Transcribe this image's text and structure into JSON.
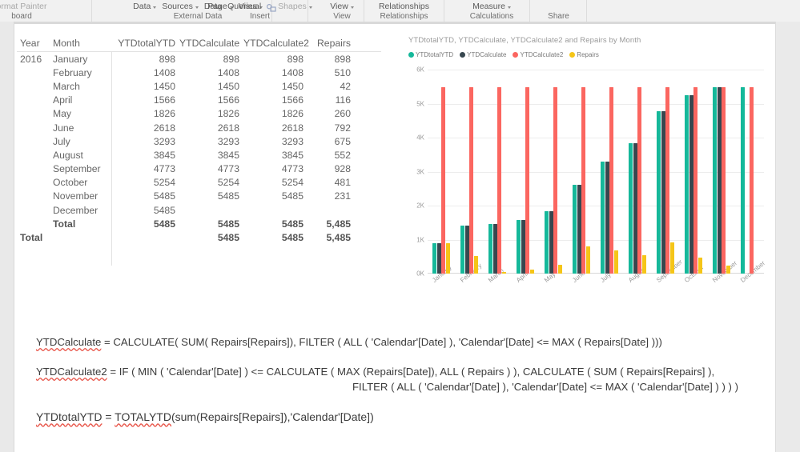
{
  "ribbon": {
    "groups": [
      {
        "name": "clipboard",
        "label": "board",
        "items": [
          {
            "text": "ormat Painter",
            "caret": false,
            "faded": true
          }
        ]
      },
      {
        "name": "external-data",
        "label": "External Data",
        "items": [
          {
            "text": "Data",
            "caret": true,
            "faded": false
          },
          {
            "text": "Sources",
            "caret": true,
            "faded": false
          },
          {
            "text": "Data",
            "caret": false,
            "faded": false
          },
          {
            "text": "Queries",
            "caret": true,
            "faded": false
          }
        ]
      },
      {
        "name": "insert",
        "label": "Insert",
        "items": [
          {
            "text": "Page",
            "caret": true,
            "faded": false
          },
          {
            "text": "Visual",
            "caret": false,
            "faded": false
          },
          {
            "text": "Shapes",
            "caret": true,
            "faded": true,
            "icon": "shapes-icon"
          }
        ]
      },
      {
        "name": "view",
        "label": "View",
        "items": [
          {
            "text": "View",
            "caret": true,
            "faded": false
          }
        ]
      },
      {
        "name": "relationships",
        "label": "Relationships",
        "items": [
          {
            "text": "Relationships",
            "caret": false,
            "faded": false
          }
        ]
      },
      {
        "name": "calculations",
        "label": "Calculations",
        "items": [
          {
            "text": "Measure",
            "caret": true,
            "faded": false
          }
        ]
      },
      {
        "name": "share",
        "label": "Share",
        "items": []
      }
    ]
  },
  "matrix": {
    "columns": [
      "Year",
      "Month",
      "YTDtotalYTD",
      "YTDCalculate",
      "YTDCalculate2",
      "Repairs"
    ],
    "year": "2016",
    "rows": [
      {
        "month": "January",
        "ytdtotalytd": "898",
        "ytdcalculate": "898",
        "ytdcalculate2": "898",
        "repairs": "898"
      },
      {
        "month": "February",
        "ytdtotalytd": "1408",
        "ytdcalculate": "1408",
        "ytdcalculate2": "1408",
        "repairs": "510"
      },
      {
        "month": "March",
        "ytdtotalytd": "1450",
        "ytdcalculate": "1450",
        "ytdcalculate2": "1450",
        "repairs": "42"
      },
      {
        "month": "April",
        "ytdtotalytd": "1566",
        "ytdcalculate": "1566",
        "ytdcalculate2": "1566",
        "repairs": "116"
      },
      {
        "month": "May",
        "ytdtotalytd": "1826",
        "ytdcalculate": "1826",
        "ytdcalculate2": "1826",
        "repairs": "260"
      },
      {
        "month": "June",
        "ytdtotalytd": "2618",
        "ytdcalculate": "2618",
        "ytdcalculate2": "2618",
        "repairs": "792"
      },
      {
        "month": "July",
        "ytdtotalytd": "3293",
        "ytdcalculate": "3293",
        "ytdcalculate2": "3293",
        "repairs": "675"
      },
      {
        "month": "August",
        "ytdtotalytd": "3845",
        "ytdcalculate": "3845",
        "ytdcalculate2": "3845",
        "repairs": "552"
      },
      {
        "month": "September",
        "ytdtotalytd": "4773",
        "ytdcalculate": "4773",
        "ytdcalculate2": "4773",
        "repairs": "928"
      },
      {
        "month": "October",
        "ytdtotalytd": "5254",
        "ytdcalculate": "5254",
        "ytdcalculate2": "5254",
        "repairs": "481"
      },
      {
        "month": "November",
        "ytdtotalytd": "5485",
        "ytdcalculate": "5485",
        "ytdcalculate2": "5485",
        "repairs": "231"
      },
      {
        "month": "December",
        "ytdtotalytd": "5485",
        "ytdcalculate": "",
        "ytdcalculate2": "",
        "repairs": ""
      }
    ],
    "subtotal": {
      "label": "Total",
      "ytdtotalytd": "5485",
      "ytdcalculate": "5485",
      "ytdcalculate2": "5485",
      "repairs": "5,485"
    },
    "grandtotal": {
      "label": "Total",
      "ytdtotalytd": "",
      "ytdcalculate": "5485",
      "ytdcalculate2": "5485",
      "repairs": "5,485"
    }
  },
  "chart_data": {
    "type": "bar",
    "title": "YTDtotalYTD, YTDCalculate, YTDCalculate2 and Repairs by Month",
    "xlabel": "",
    "ylabel": "",
    "ylim": [
      0,
      6000
    ],
    "yticks": [
      "0K",
      "1K",
      "2K",
      "3K",
      "4K",
      "5K",
      "6K"
    ],
    "ytickvalues": [
      0,
      1000,
      2000,
      3000,
      4000,
      5000,
      6000
    ],
    "grid": true,
    "legend_position": "top-left",
    "categories": [
      "January",
      "February",
      "March",
      "April",
      "May",
      "June",
      "July",
      "August",
      "September",
      "October",
      "November",
      "December"
    ],
    "series": [
      {
        "name": "YTDtotalYTD",
        "color": "#15b89a",
        "values": [
          898,
          1408,
          1450,
          1566,
          1826,
          2618,
          3293,
          3845,
          4773,
          5254,
          5485,
          5485
        ]
      },
      {
        "name": "YTDCalculate",
        "color": "#37474f",
        "values": [
          898,
          1408,
          1450,
          1566,
          1826,
          2618,
          3293,
          3845,
          4773,
          5254,
          5485,
          null
        ]
      },
      {
        "name": "YTDCalculate2",
        "color": "#fb6660",
        "values": [
          5485,
          5485,
          5485,
          5485,
          5485,
          5485,
          5485,
          5485,
          5485,
          5485,
          5485,
          5485
        ]
      },
      {
        "name": "Repairs",
        "color": "#f5c518",
        "values": [
          898,
          510,
          42,
          116,
          260,
          792,
          675,
          552,
          928,
          481,
          231,
          null
        ]
      }
    ]
  },
  "formulas": [
    {
      "name": "YTDCalculate",
      "lines": [
        {
          "measure": "YTDCalculate",
          "text": " = CALCULATE( SUM( Repairs[Repairs]), FILTER ( ALL ( 'Calendar'[Date] ), 'Calendar'[Date] <= MAX ( Repairs[Date] )))",
          "indent": false
        }
      ]
    },
    {
      "name": "YTDCalculate2",
      "lines": [
        {
          "measure": "YTDCalculate2",
          "text": " = IF ( MIN ( 'Calendar'[Date] ) <= CALCULATE ( MAX (Repairs[Date]), ALL ( Repairs ) ), CALCULATE ( SUM ( Repairs[Repairs] ),",
          "indent": false
        },
        {
          "measure": "",
          "text": "FILTER ( ALL ( 'Calendar'[Date] ), 'Calendar'[Date] <= MAX ( 'Calendar'[Date] ) ) ) )",
          "indent": true
        }
      ]
    },
    {
      "name": "YTDtotalYTD",
      "lines": [
        {
          "measure": "YTDtotalYTD",
          "text": " = ",
          "indent": false,
          "measure2": "TOTALYTD",
          "text2": "(sum(Repairs[Repairs]),'Calendar'[Date])"
        }
      ]
    }
  ]
}
